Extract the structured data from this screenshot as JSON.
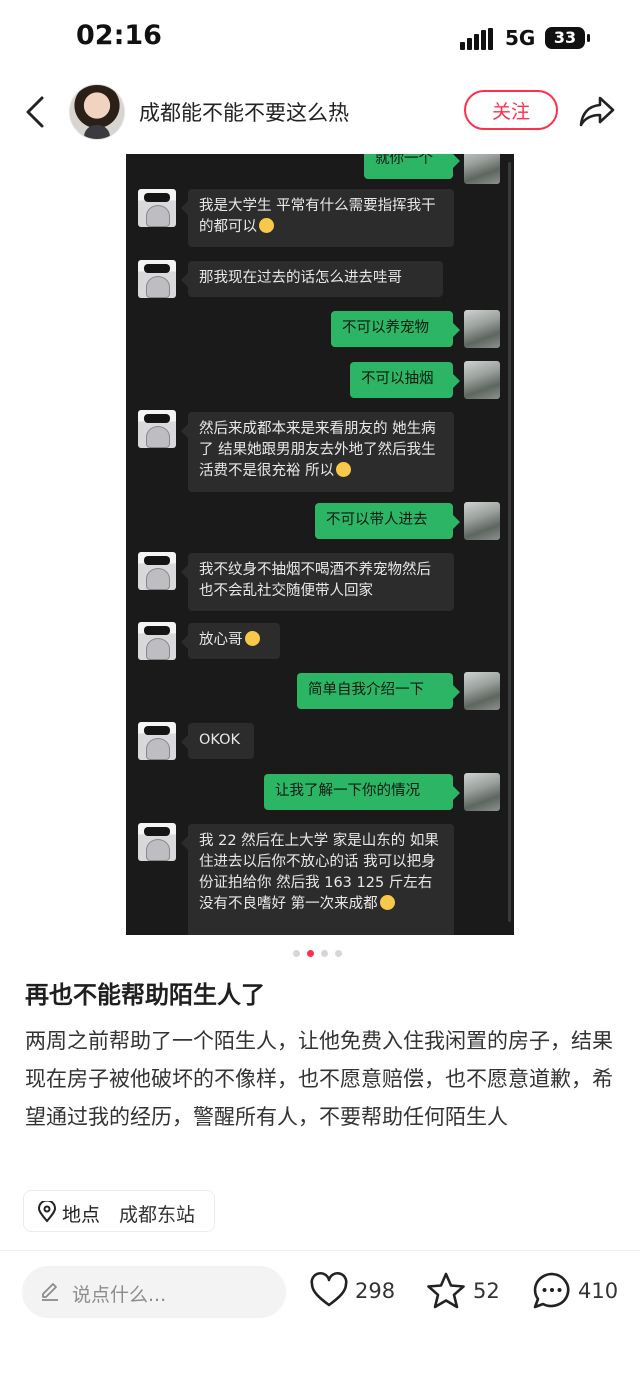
{
  "status_bar": {
    "time": "02:16",
    "network": "5G",
    "battery": "33"
  },
  "header": {
    "author_name": "成都能不能不要这么热",
    "follow_label": "关注"
  },
  "chat": {
    "messages": [
      {
        "side": "out",
        "text": "就你一个"
      },
      {
        "side": "in",
        "text": "我是大学生 平常有什么需要指挥我干的都可以"
      },
      {
        "side": "in",
        "text": "那我现在过去的话怎么进去哇哥"
      },
      {
        "side": "out",
        "text": "不可以养宠物"
      },
      {
        "side": "out",
        "text": "不可以抽烟"
      },
      {
        "side": "in",
        "text": "然后来成都本来是来看朋友的 她生病了 结果她跟男朋友去外地了然后我生活费不是很充裕 所以"
      },
      {
        "side": "out",
        "text": "不可以带人进去"
      },
      {
        "side": "in",
        "text": "我不纹身不抽烟不喝酒不养宠物然后也不会乱社交随便带人回家"
      },
      {
        "side": "in",
        "text": "放心哥"
      },
      {
        "side": "out",
        "text": "简单自我介绍一下"
      },
      {
        "side": "in",
        "text": "OKOK"
      },
      {
        "side": "out",
        "text": "让我了解一下你的情况"
      },
      {
        "side": "in",
        "text": "我 22 然后在上大学 家是山东的 如果住进去以后你不放心的话 我可以把身份证拍给你 然后我 163 125 斤左右 没有不良嗜好 第一次来成都"
      }
    ]
  },
  "carousel": {
    "total": 4,
    "active": 2
  },
  "post": {
    "title": "再也不能帮助陌生人了",
    "body": "两周之前帮助了一个陌生人，让他免费入住我闲置的房子，结果现在房子被他破坏的不像样，也不愿意赔偿，也不愿意道歉，希望通过我的经历，警醒所有人，不要帮助任何陌生人",
    "location_key": "地点",
    "location_value": "成都东站"
  },
  "bottom_bar": {
    "comment_placeholder": "说点什么...",
    "likes": "298",
    "stars": "52",
    "comments": "410"
  },
  "colors": {
    "accent": "#ff2e4d",
    "chat_green": "#2bb565",
    "chat_bg": "#1a1a1a"
  }
}
